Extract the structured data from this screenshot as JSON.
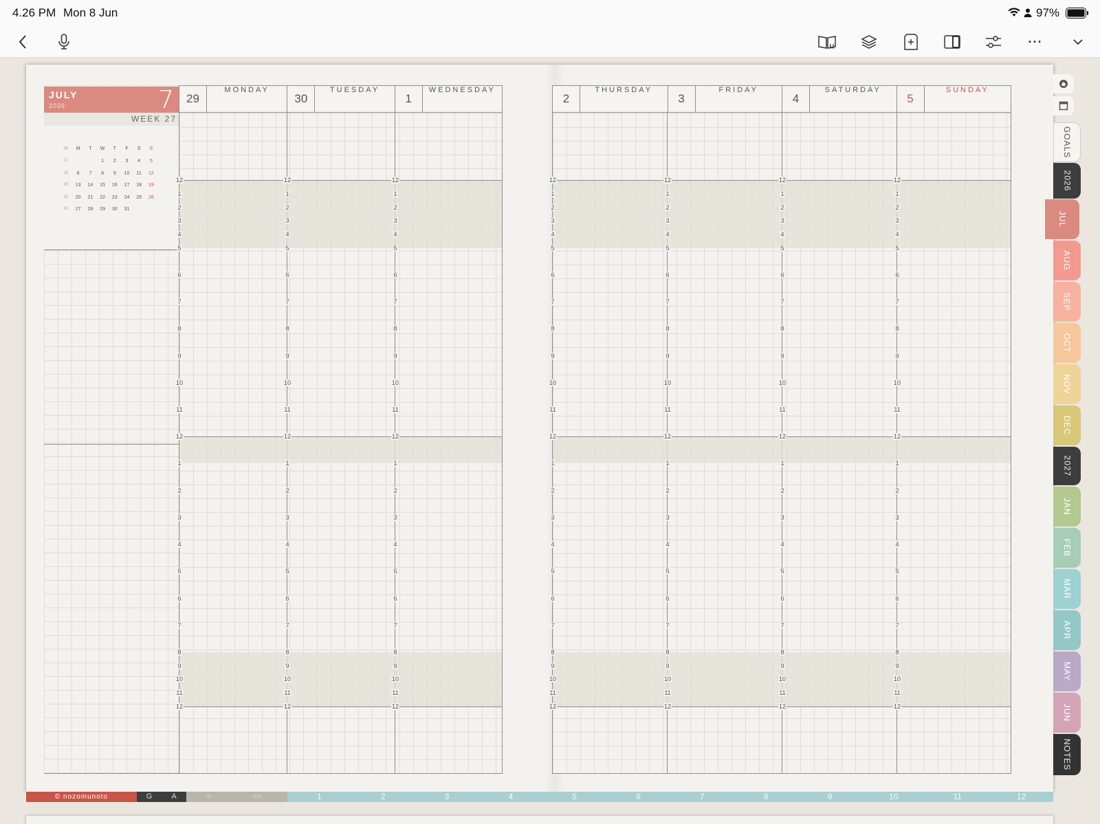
{
  "status": {
    "time": "4.26 PM",
    "date": "Mon 8 Jun",
    "battery": "97%"
  },
  "toolbar": {
    "icons": [
      "back-icon",
      "microphone-icon",
      "book-icon",
      "layers-icon",
      "add-page-icon",
      "split-view-icon",
      "sliders-icon",
      "more-icon",
      "chevron-down-icon"
    ],
    "more": "···"
  },
  "planner": {
    "month": "JULY",
    "year": "2026",
    "month_num": "7",
    "week_label": "WEEK",
    "week_num": "27",
    "mini_calendar": {
      "headers": [
        "W",
        "M",
        "T",
        "W",
        "T",
        "F",
        "S",
        "S"
      ],
      "rows": [
        [
          "27",
          "",
          "",
          "1",
          "2",
          "3",
          "4",
          "5"
        ],
        [
          "28",
          "6",
          "7",
          "8",
          "9",
          "10",
          "11",
          "12"
        ],
        [
          "29",
          "13",
          "14",
          "15",
          "16",
          "17",
          "18",
          "19"
        ],
        [
          "30",
          "20",
          "21",
          "22",
          "23",
          "24",
          "25",
          "26"
        ],
        [
          "31",
          "27",
          "28",
          "29",
          "30",
          "31",
          "",
          ""
        ]
      ]
    },
    "left_days": [
      {
        "num": "29",
        "name": "MONDAY"
      },
      {
        "num": "30",
        "name": "TUESDAY"
      },
      {
        "num": "1",
        "name": "WEDNESDAY"
      }
    ],
    "right_days": [
      {
        "num": "2",
        "name": "THURSDAY"
      },
      {
        "num": "3",
        "name": "FRIDAY"
      },
      {
        "num": "4",
        "name": "SATURDAY"
      },
      {
        "num": "5",
        "name": "SUNDAY"
      }
    ],
    "hours": [
      "12",
      "1",
      "2",
      "3",
      "4",
      "5",
      "6",
      "7",
      "8",
      "9",
      "10",
      "11",
      "12",
      "1",
      "2",
      "3",
      "4",
      "5",
      "6",
      "7",
      "8",
      "9",
      "10",
      "11",
      "12"
    ],
    "copyright": "© nozomunoto",
    "bottom_letters": [
      "G",
      "A",
      "○",
      "○○"
    ],
    "bottom_months": [
      "1",
      "2",
      "3",
      "4",
      "5",
      "6",
      "7",
      "8",
      "9",
      "10",
      "11",
      "12"
    ]
  },
  "side_tabs": [
    {
      "label": "GOALS",
      "bg": "#f6f5f2",
      "fg": "#555"
    },
    {
      "label": "2026",
      "bg": "#3d3d3d",
      "fg": "#eee"
    },
    {
      "label": "JUL",
      "bg": "#db8a80",
      "fg": "#fff"
    },
    {
      "label": "AUG",
      "bg": "#f39a8f",
      "fg": "#fff"
    },
    {
      "label": "SEP",
      "bg": "#f7b3a0",
      "fg": "#fff"
    },
    {
      "label": "OCT",
      "bg": "#f6c79c",
      "fg": "#fff"
    },
    {
      "label": "NOV",
      "bg": "#efd49a",
      "fg": "#fff"
    },
    {
      "label": "DEC",
      "bg": "#d8c878",
      "fg": "#fff"
    },
    {
      "label": "2027",
      "bg": "#3d3d3d",
      "fg": "#eee"
    },
    {
      "label": "JAN",
      "bg": "#b3c98f",
      "fg": "#fff"
    },
    {
      "label": "FEB",
      "bg": "#a6cdb6",
      "fg": "#fff"
    },
    {
      "label": "MAR",
      "bg": "#9ed1d2",
      "fg": "#fff"
    },
    {
      "label": "APR",
      "bg": "#93c8c7",
      "fg": "#fff"
    },
    {
      "label": "MAY",
      "bg": "#b9a9c7",
      "fg": "#fff"
    },
    {
      "label": "JUN",
      "bg": "#d3a4b6",
      "fg": "#fff"
    },
    {
      "label": "NOTES",
      "bg": "#333333",
      "fg": "#eee"
    }
  ],
  "colors": {
    "accent": "#db8a80",
    "sunday": "#c9544a",
    "strip_red": "#c9544a",
    "strip_teal": "#a9cfd0"
  }
}
